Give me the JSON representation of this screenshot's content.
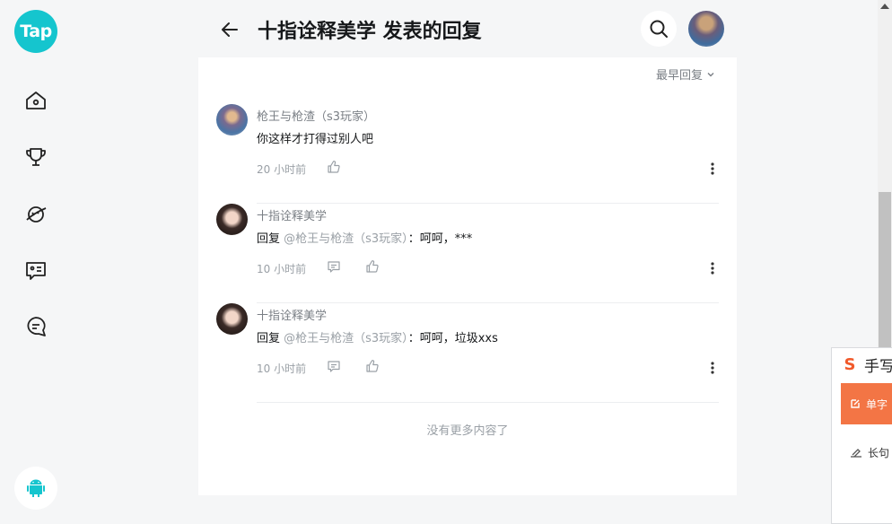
{
  "app": {
    "logo_text": "Tap"
  },
  "header": {
    "title": "十指诠释美学 发表的回复"
  },
  "sort": {
    "label": "最早回复"
  },
  "replies": [
    {
      "name": "枪王与枪渣（s3玩家）",
      "prefix": "",
      "mention": "",
      "text": "你这样才打得过别人吧",
      "time": "20 小时前"
    },
    {
      "name": "十指诠释美学",
      "prefix": "回复 ",
      "mention": "@枪王与枪渣（s3玩家）",
      "text": "：呵呵，***",
      "time": "10 小时前"
    },
    {
      "name": "十指诠释美学",
      "prefix": "回复 ",
      "mention": "@枪王与枪渣（s3玩家）",
      "text": "：呵呵，垃圾xxs",
      "time": "10 小时前"
    }
  ],
  "footer": {
    "no_more": "没有更多内容了"
  },
  "ime": {
    "logo": "S",
    "title": "手写",
    "tab_single": "单字",
    "tab_long": "长句"
  },
  "colors": {
    "brand": "#15c5ce",
    "ime_accent": "#f37545"
  },
  "icons": [
    "home-icon",
    "trophy-icon",
    "planet-icon",
    "message-card-icon",
    "chat-icon",
    "android-icon",
    "back-arrow-icon",
    "search-icon",
    "chevron-down-icon",
    "comment-icon",
    "like-icon",
    "more-icon"
  ]
}
